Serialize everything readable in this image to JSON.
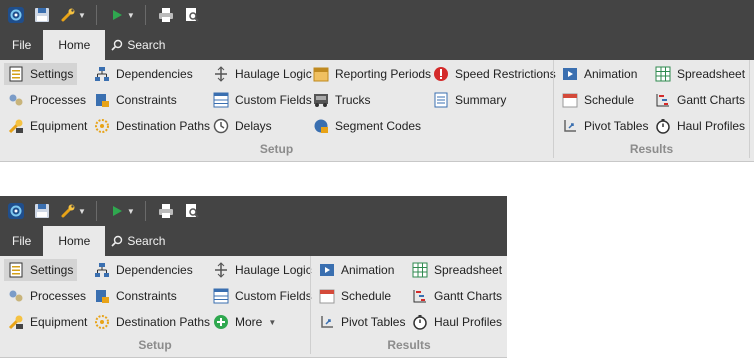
{
  "quick_access": {
    "icons": [
      "app-logo-icon",
      "save-icon",
      "wrench-icon",
      "run-icon",
      "print-icon",
      "print-preview-icon"
    ]
  },
  "tabs": {
    "file": "File",
    "home": "Home",
    "search": "Search"
  },
  "ribbon1": {
    "setup": {
      "label": "Setup",
      "col1": [
        "Settings",
        "Processes",
        "Equipment"
      ],
      "col2": [
        "Dependencies",
        "Constraints",
        "Destination Paths"
      ],
      "col3": [
        "Haulage Logic",
        "Custom Fields",
        "Delays"
      ],
      "col4": [
        "Reporting Periods",
        "Trucks",
        "Segment Codes"
      ],
      "col5": [
        "Speed Restrictions",
        "Summary"
      ]
    },
    "results": {
      "label": "Results",
      "col1": [
        "Animation",
        "Schedule",
        "Pivot Tables"
      ],
      "col2": [
        "Spreadsheet",
        "Gantt Charts",
        "Haul Profiles"
      ]
    }
  },
  "ribbon2": {
    "setup": {
      "label": "Setup",
      "col1": [
        "Settings",
        "Processes",
        "Equipment"
      ],
      "col2": [
        "Dependencies",
        "Constraints",
        "Destination Paths"
      ],
      "col3": [
        "Haulage Logic",
        "Custom Fields",
        "More"
      ]
    },
    "results": {
      "label": "Results",
      "col1": [
        "Animation",
        "Schedule",
        "Pivot Tables"
      ],
      "col2": [
        "Spreadsheet",
        "Gantt Charts",
        "Haul Profiles"
      ]
    }
  },
  "colors": {
    "titlebar": "#444444",
    "ribbon": "#e9e9e9",
    "group_label": "#8c8c8c"
  }
}
